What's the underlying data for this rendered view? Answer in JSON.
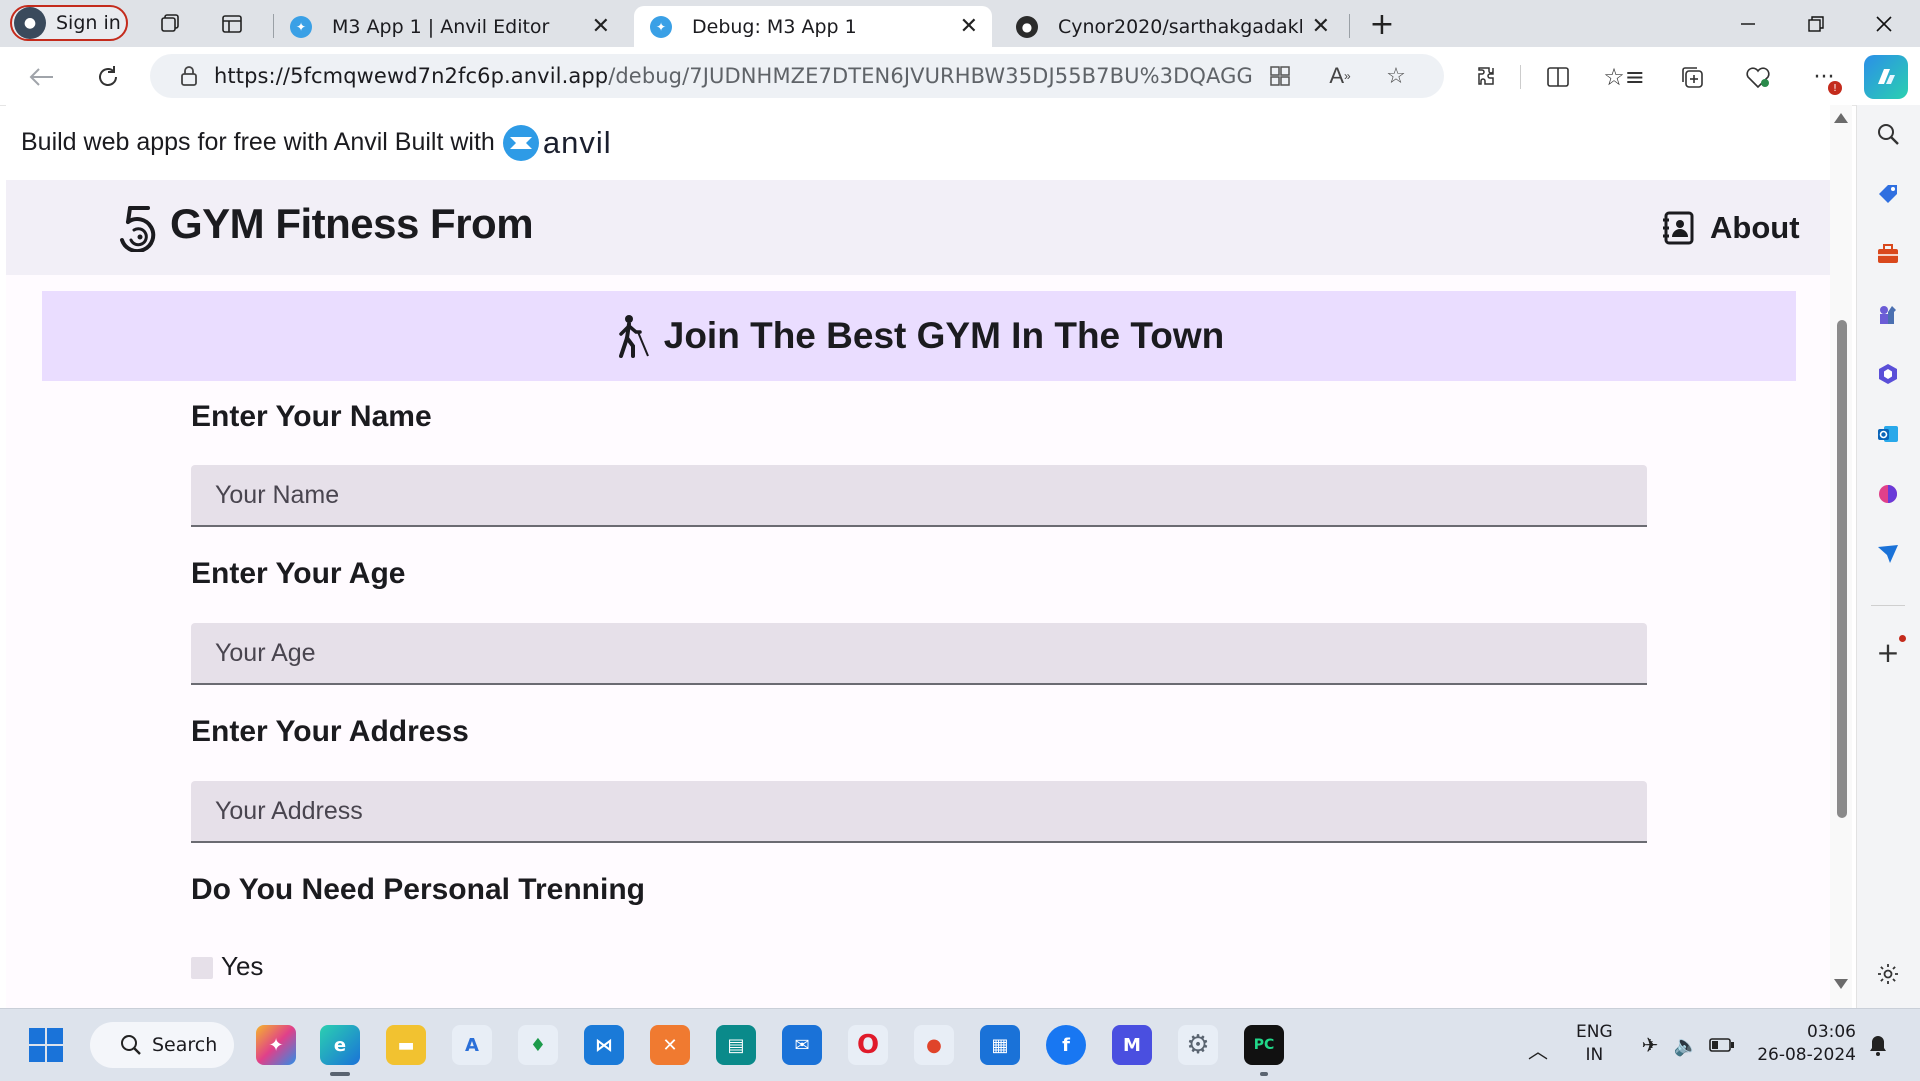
{
  "browser": {
    "signin_label": "Sign in",
    "tabs": [
      {
        "title": "M3 App 1 | Anvil Editor",
        "active": false
      },
      {
        "title": "Debug: M3 App 1",
        "active": true
      },
      {
        "title": "Cynor2020/sarthakgadakh",
        "active": false
      }
    ],
    "url_domain": "https://5fcmqwewd7n2fc6p.anvil.app",
    "url_path": "/debug/7JUDNHMZE7DTEN6JVURHBW35DJ55B7BU%3DQAGGQH76WO..."
  },
  "banner": {
    "text": "Build web apps for free with Anvil Built with",
    "logo_word": "anvil"
  },
  "app": {
    "title": "GYM Fitness From",
    "about_label": "About",
    "hero_title": "Join The Best GYM In The Town",
    "fields": [
      {
        "label": "Enter Your Name",
        "placeholder": "Your Name"
      },
      {
        "label": "Enter Your Age",
        "placeholder": "Your Age"
      },
      {
        "label": "Enter Your Address",
        "placeholder": "Your Address"
      }
    ],
    "personal_training_label": "Do You Need Personal Trenning",
    "checkbox_label": "Yes",
    "colors": {
      "app_bar": "#f2eff7",
      "hero": "#eaddff",
      "input_bg": "#e6e0e9"
    }
  },
  "taskbar": {
    "search_label": "Search",
    "language_top": "ENG",
    "language_bottom": "IN",
    "time": "03:06",
    "date": "26-08-2024"
  }
}
